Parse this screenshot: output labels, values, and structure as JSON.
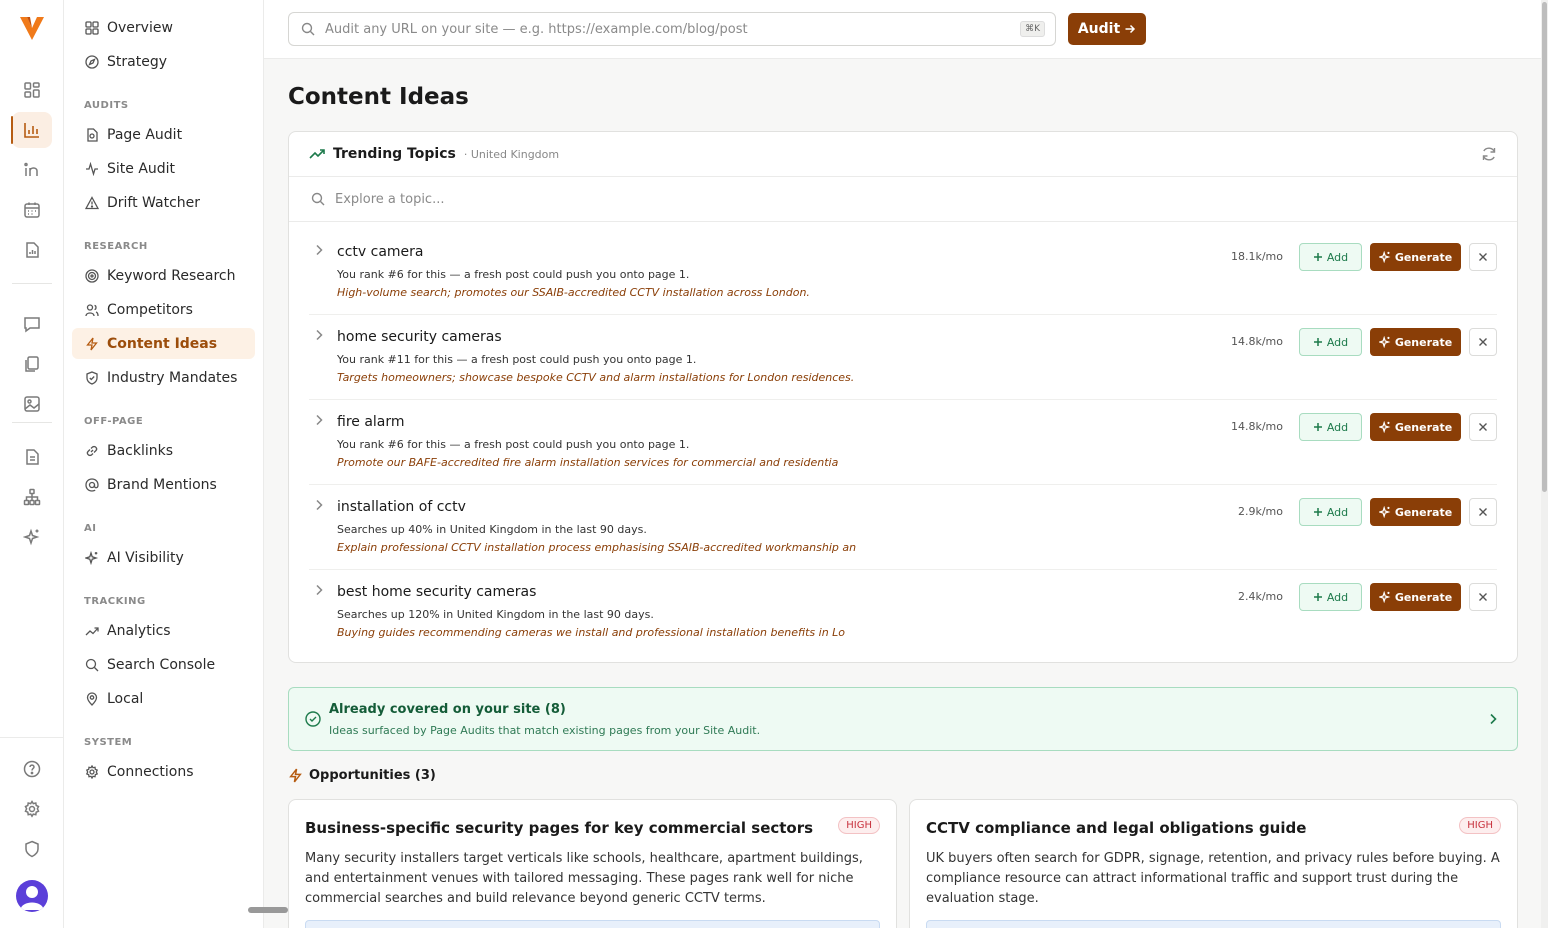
{
  "colors": {
    "accent": "#8a3e07",
    "active_bg": "#fdf1e5",
    "success": "#1d7a4b",
    "badge_red": "#c8323e"
  },
  "rail": {
    "icons": [
      "logo-icon",
      "dashboard-icon",
      "chart-bar-icon",
      "linkedin-icon",
      "calendar-icon",
      "report-icon",
      "message-icon",
      "documents-icon",
      "image-icon",
      "file-text-icon",
      "sitemap-icon",
      "sparkles-icon",
      "help-icon",
      "settings-icon",
      "shield-icon",
      "avatar"
    ]
  },
  "sidebar": {
    "top_items": [
      {
        "label": "Overview",
        "icon": "grid-icon"
      },
      {
        "label": "Strategy",
        "icon": "compass-icon"
      }
    ],
    "sections": {
      "audits": "AUDITS",
      "research": "RESEARCH",
      "offpage": "OFF-PAGE",
      "ai": "AI",
      "tracking": "TRACKING",
      "system": "SYSTEM"
    },
    "items": {
      "page_audit": "Page Audit",
      "site_audit": "Site Audit",
      "drift_watcher": "Drift Watcher",
      "keyword_research": "Keyword Research",
      "competitors": "Competitors",
      "content_ideas": "Content Ideas",
      "industry_mandates": "Industry Mandates",
      "backlinks": "Backlinks",
      "brand_mentions": "Brand Mentions",
      "ai_visibility": "AI Visibility",
      "analytics": "Analytics",
      "search_console": "Search Console",
      "local": "Local",
      "connections": "Connections"
    }
  },
  "topbar": {
    "search_placeholder": "Audit any URL on your site — e.g. https://example.com/blog/post",
    "shortcut": "⌘K",
    "audit_label": "Audit"
  },
  "page": {
    "title": "Content Ideas"
  },
  "trending": {
    "title": "Trending Topics",
    "location": "· United Kingdom",
    "search_placeholder": "Explore a topic...",
    "add_label": "Add",
    "generate_label": "Generate",
    "rows": [
      {
        "keyword": "cctv camera",
        "sub": "You rank #6 for this — a fresh post could push you onto page 1.",
        "note": "High-volume search; promotes our SSAIB-accredited CCTV installation across London.",
        "volume": "18.1k/mo"
      },
      {
        "keyword": "home security cameras",
        "sub": "You rank #11 for this — a fresh post could push you onto page 1.",
        "note": "Targets homeowners; showcase bespoke CCTV and alarm installations for London residences.",
        "volume": "14.8k/mo"
      },
      {
        "keyword": "fire alarm",
        "sub": "You rank #6 for this — a fresh post could push you onto page 1.",
        "note": "Promote our BAFE-accredited fire alarm installation services for commercial and residentia",
        "volume": "14.8k/mo"
      },
      {
        "keyword": "installation of cctv",
        "sub": "Searches up 40% in United Kingdom in the last 90 days.",
        "note": "Explain professional CCTV installation process emphasising SSAIB-accredited workmanship an",
        "volume": "2.9k/mo"
      },
      {
        "keyword": "best home security cameras",
        "sub": "Searches up 120% in United Kingdom in the last 90 days.",
        "note": "Buying guides recommending cameras we install and professional installation benefits in Lo",
        "volume": "2.4k/mo"
      }
    ]
  },
  "covered": {
    "title": "Already covered on your site (8)",
    "desc": "Ideas surfaced by Page Audits that match existing pages from your Site Audit."
  },
  "opportunities": {
    "title": "Opportunities (3)",
    "cards": [
      {
        "title": "Business-specific security pages for key commercial sectors",
        "badge": "HIGH",
        "desc": "Many security installers target verticals like schools, healthcare, apartment buildings, and entertainment venues with tailored messaging. These pages rank well for niche commercial searches and build relevance beyond generic CCTV terms."
      },
      {
        "title": "CCTV compliance and legal obligations guide",
        "badge": "HIGH",
        "desc": "UK buyers often search for GDPR, signage, retention, and privacy rules before buying. A compliance resource can attract informational traffic and support trust during the evaluation stage."
      }
    ]
  }
}
